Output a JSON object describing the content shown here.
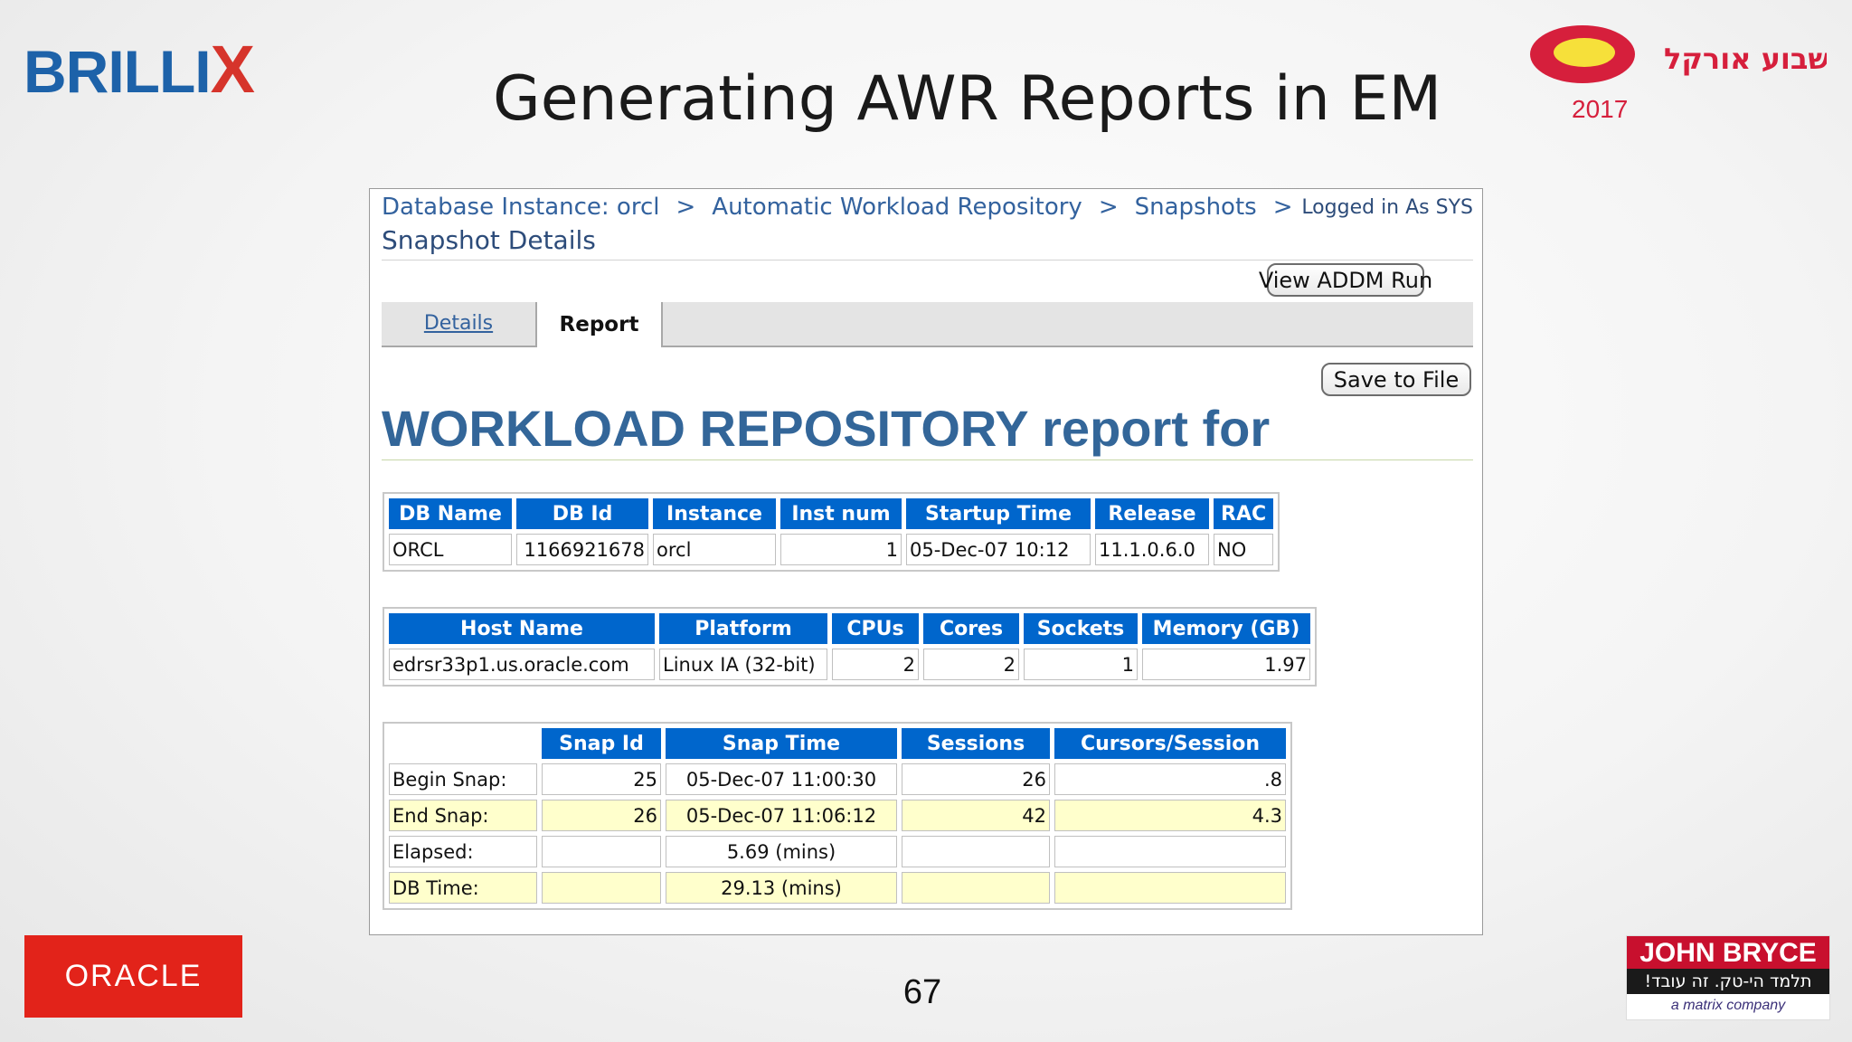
{
  "slide": {
    "title": "Generating AWR Reports in EM",
    "page_number": "67",
    "brillix_main": "BRILLI",
    "brillix_x": "X",
    "oracle_logo": "ORACLE",
    "oracle_week_logo": {
      "hebrew": "שבוע אורקל",
      "year": "2017"
    },
    "john_bryce": {
      "name": "JOHN BRYCE",
      "tagline": "תלמד הי-טק. זה עובד!",
      "sub": "a matrix company"
    },
    "colors": {
      "link": "#33629e",
      "header_blue": "#0066cc",
      "title_blue": "#336699",
      "alt_row": "#ffffcc"
    }
  },
  "em": {
    "breadcrumbs": [
      "Database Instance: orcl",
      "Automatic Workload Repository",
      "Snapshots"
    ],
    "separator": ">",
    "logged_in": "Logged in As SYS",
    "page_heading": "Snapshot Details",
    "view_addm_button": "View ADDM Run",
    "tabs": [
      "Details",
      "Report"
    ],
    "save_button": "Save to File",
    "report_title": "WORKLOAD REPOSITORY report for"
  },
  "db_table": {
    "headers": [
      "DB Name",
      "DB Id",
      "Instance",
      "Inst num",
      "Startup Time",
      "Release",
      "RAC"
    ],
    "row": [
      "ORCL",
      "1166921678",
      "orcl",
      "1",
      "05-Dec-07 10:12",
      "11.1.0.6.0",
      "NO"
    ]
  },
  "host_table": {
    "headers": [
      "Host Name",
      "Platform",
      "CPUs",
      "Cores",
      "Sockets",
      "Memory (GB)"
    ],
    "row": [
      "edrsr33p1.us.oracle.com",
      "Linux IA (32-bit)",
      "2",
      "2",
      "1",
      "1.97"
    ]
  },
  "snap_table": {
    "headers": [
      "",
      "Snap Id",
      "Snap Time",
      "Sessions",
      "Cursors/Session"
    ],
    "rows": [
      [
        "Begin Snap:",
        "25",
        "05-Dec-07 11:00:30",
        "26",
        ".8"
      ],
      [
        "End Snap:",
        "26",
        "05-Dec-07 11:06:12",
        "42",
        "4.3"
      ],
      [
        "Elapsed:",
        "",
        "5.69 (mins)",
        "",
        ""
      ],
      [
        "DB Time:",
        "",
        "29.13 (mins)",
        "",
        ""
      ]
    ]
  }
}
